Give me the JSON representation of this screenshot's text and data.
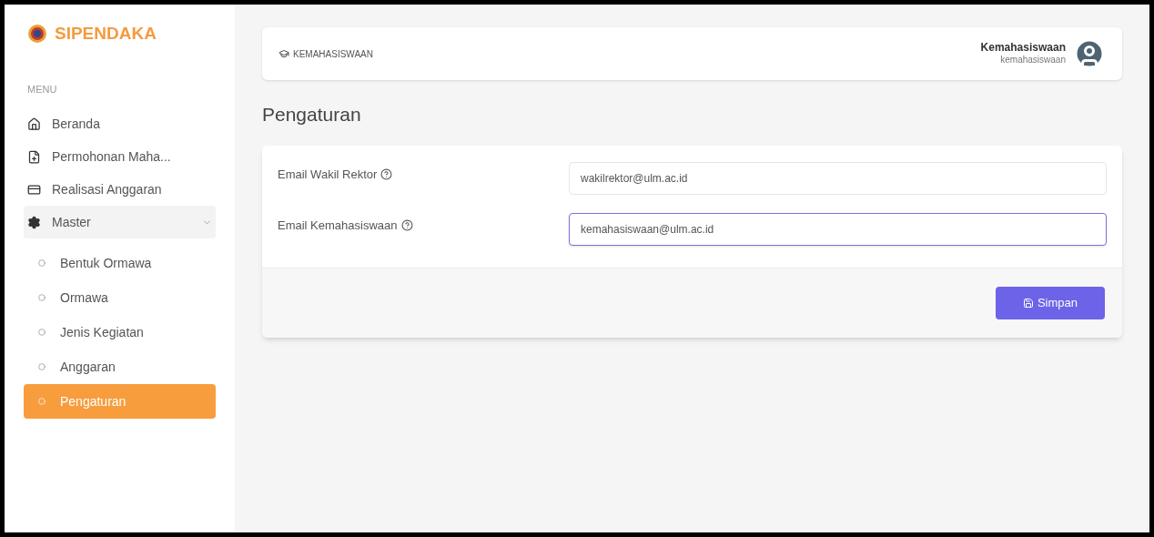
{
  "brand": {
    "name": "SIPENDAKA"
  },
  "sidebar": {
    "heading": "MENU",
    "items": [
      {
        "kind": "link",
        "label": "Beranda"
      },
      {
        "kind": "link",
        "label": "Permohonan Maha..."
      },
      {
        "kind": "link",
        "label": "Realisasi Anggaran"
      },
      {
        "kind": "group",
        "label": "Master",
        "expanded": true,
        "children": [
          {
            "label": "Bentuk Ormawa",
            "selected": false
          },
          {
            "label": "Ormawa",
            "selected": false
          },
          {
            "label": "Jenis Kegiatan",
            "selected": false
          },
          {
            "label": "Anggaran",
            "selected": false
          },
          {
            "label": "Pengaturan",
            "selected": true
          }
        ]
      }
    ]
  },
  "header": {
    "breadcrumb": "KEMAHASISWAAN",
    "user": {
      "name": "Kemahasiswaan",
      "username": "kemahasiswaan"
    }
  },
  "page_title": "Pengaturan",
  "form": {
    "fields": [
      {
        "label": "Email Wakil Rektor",
        "value": "wakilrektor@ulm.ac.id",
        "focused": false
      },
      {
        "label": "Email Kemahasiswaan",
        "value": "kemahasiswaan@ulm.ac.id",
        "focused": true
      }
    ],
    "submit": "Simpan"
  }
}
